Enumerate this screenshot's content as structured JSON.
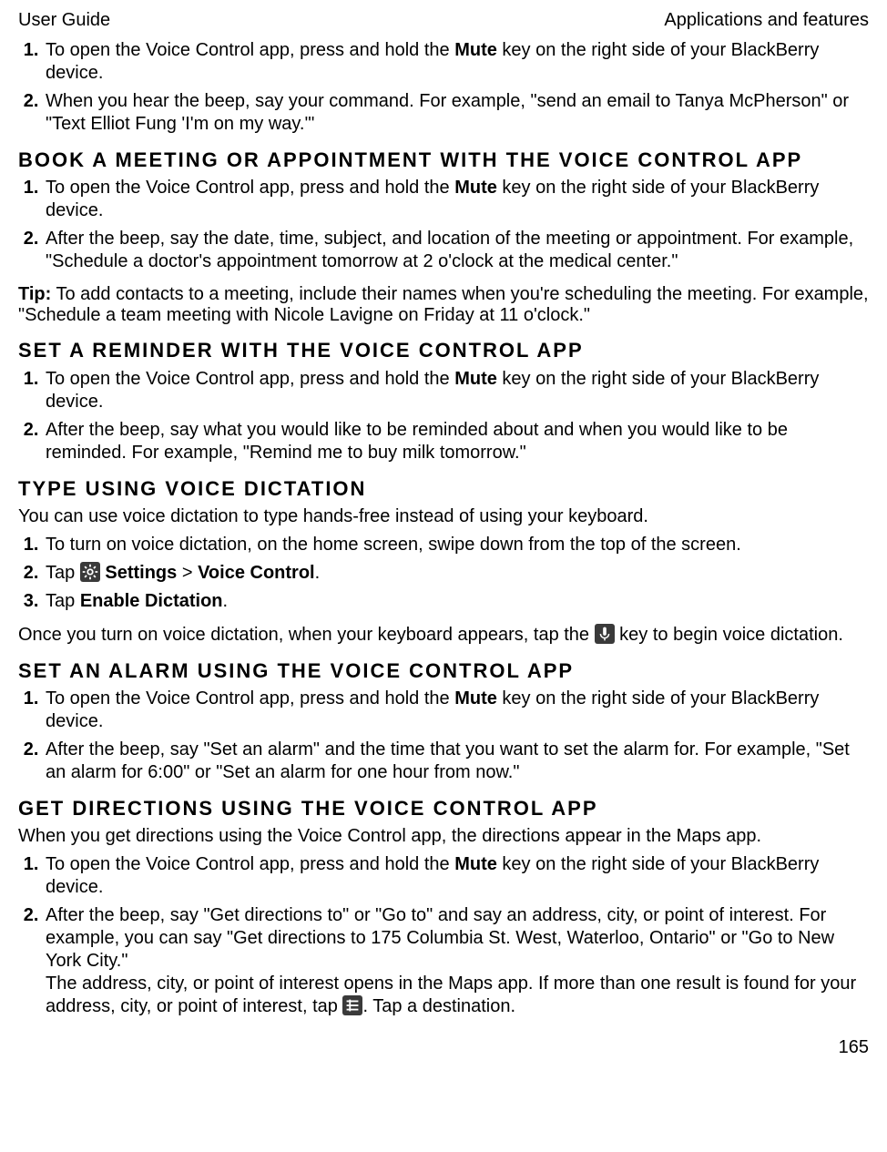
{
  "header": {
    "left": "User Guide",
    "right": "Applications and features"
  },
  "intro": {
    "items": [
      {
        "pre": "To open the Voice Control app, press and hold the ",
        "bold": "Mute",
        "post": " key on the right side of your BlackBerry device."
      },
      {
        "text": "When you hear the beep, say your command. For example, \"send an email to Tanya McPherson\" or \"Text Elliot Fung 'I'm on my way.'\""
      }
    ]
  },
  "sections": {
    "book": {
      "title": "Book a meeting or appointment with the Voice Control app",
      "items": [
        {
          "pre": "To open the Voice Control app, press and hold the ",
          "bold": "Mute",
          "post": " key on the right side of your BlackBerry device."
        },
        {
          "text": "After the beep, say the date, time, subject, and location of the meeting or appointment. For example, \"Schedule a doctor's appointment tomorrow at 2 o'clock at the medical center.\""
        }
      ],
      "tip_label": "Tip:",
      "tip": " To add contacts to a meeting, include their names when you're scheduling the meeting. For example, \"Schedule a team meeting with Nicole Lavigne on Friday at 11 o'clock.\""
    },
    "reminder": {
      "title": "Set a reminder with the Voice Control app",
      "items": [
        {
          "pre": "To open the Voice Control app, press and hold the ",
          "bold": "Mute",
          "post": " key on the right side of your BlackBerry device."
        },
        {
          "text": "After the beep, say what you would like to be reminded about and when you would like to be reminded. For example, \"Remind me to buy milk tomorrow.\""
        }
      ]
    },
    "dictation": {
      "title": "Type using voice dictation",
      "intro": "You can use voice dictation to type hands-free instead of using your keyboard.",
      "item1": "To turn on voice dictation, on the home screen, swipe down from the top of the screen.",
      "item2_pre": "Tap ",
      "item2_settings": " Settings",
      "item2_gt": " > ",
      "item2_vc": "Voice Control",
      "item2_post": ".",
      "item3_pre": "Tap ",
      "item3_bold": "Enable Dictation",
      "item3_post": ".",
      "outro_pre": "Once you turn on voice dictation, when your keyboard appears, tap the ",
      "outro_post": " key to begin voice dictation."
    },
    "alarm": {
      "title": "Set an alarm using the Voice Control app",
      "items": [
        {
          "pre": "To open the Voice Control app, press and hold the ",
          "bold": "Mute",
          "post": " key on the right side of your BlackBerry device."
        },
        {
          "text": "After the beep, say \"Set an alarm\" and the time that you want to set the alarm for. For example, \"Set an alarm for 6:00\" or \"Set an alarm for one hour from now.\""
        }
      ]
    },
    "directions": {
      "title": "Get directions using the Voice Control app",
      "intro": "When you get directions using the Voice Control app, the directions appear in the Maps app.",
      "item1_pre": "To open the Voice Control app, press and hold the ",
      "item1_bold": "Mute",
      "item1_post": " key on the right side of your BlackBerry device.",
      "item2a": "After the beep, say \"Get directions to\" or \"Go to\" and say an address, city, or point of interest. For example, you can say \"Get directions to 175 Columbia St. West, Waterloo, Ontario\" or \"Go to New York City.\"",
      "item2b_pre": "The address, city, or point of interest opens in the Maps app. If more than one result is found for your address, city, or point of interest, tap ",
      "item2b_post": ". Tap a destination."
    }
  },
  "page_number": "165"
}
